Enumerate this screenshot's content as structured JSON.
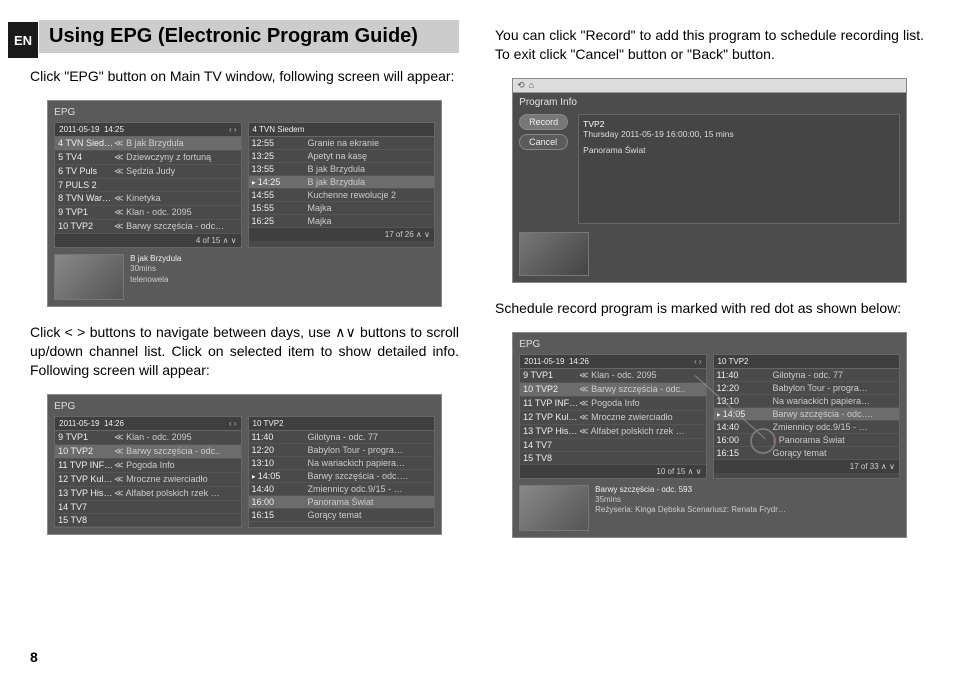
{
  "langBadge": "EN",
  "pageNumber": "8",
  "header": "Using EPG (Electronic Program Guide)",
  "para1": "Click \"EPG\" button on Main TV window, following screen will appear:",
  "para2": "Click < > buttons to navigate between days, use ∧∨ buttons to scroll up/down channel list. Click on selected item to show detailed info. Following screen will appear:",
  "para3": "You can click \"Record\" to add this program to schedule recording list. To exit click \"Cancel\" button or \"Back\" button.",
  "para4": "Schedule record program is marked with red dot as shown below:",
  "shot1": {
    "title": "EPG",
    "date": "2011-05-19",
    "time": "14:25",
    "rightHeader": "4 TVN Siedem",
    "leftRows": [
      {
        "ch": "4 TVN Siedem",
        "prog": "≪ B jak Brzydula",
        "sel": true
      },
      {
        "ch": "5 TV4",
        "prog": "≪ Dziewczyny z fortuną"
      },
      {
        "ch": "6 TV Puls",
        "prog": "≪ Sędzia Judy"
      },
      {
        "ch": "7 PULS 2",
        "prog": ""
      },
      {
        "ch": "8 TVN Warsz…",
        "prog": "≪ Kinetyka"
      },
      {
        "ch": "9 TVP1",
        "prog": "≪ Klan - odc. 2095"
      },
      {
        "ch": "10 TVP2",
        "prog": "≪ Barwy szczęścia - odc…"
      }
    ],
    "leftPager": "4 of 15  ∧ ∨",
    "rightRows": [
      {
        "t": "12:55",
        "p": "Granie na ekranie"
      },
      {
        "t": "13:25",
        "p": "Apetyt na kasę"
      },
      {
        "t": "13:55",
        "p": "B jak Brzydula"
      },
      {
        "t": "14:25",
        "p": "B jak Brzydula",
        "sel": true,
        "play": true
      },
      {
        "t": "14:55",
        "p": "Kuchenne rewolucje 2"
      },
      {
        "t": "15:55",
        "p": "Majka"
      },
      {
        "t": "16:25",
        "p": "Majka"
      }
    ],
    "rightPager": "17 of 26  ∧ ∨",
    "detailTitle": "B jak Brzydula",
    "detailDur": "30mins",
    "detailGenre": "telenowela"
  },
  "shot2": {
    "title": "EPG",
    "date": "2011-05-19",
    "time": "14:26",
    "rightHeader": "10 TVP2",
    "leftRows": [
      {
        "ch": "9 TVP1",
        "prog": "≪ Klan - odc. 2095"
      },
      {
        "ch": "10 TVP2",
        "prog": "≪ Barwy szczęścia - odc..",
        "sel": true
      },
      {
        "ch": "11 TVP INFO …",
        "prog": "≪ Pogoda Info"
      },
      {
        "ch": "12 TVP Kultura",
        "prog": "≪ Mroczne zwierciadło"
      },
      {
        "ch": "13 TVP Historia",
        "prog": "≪ Alfabet polskich rzek …"
      },
      {
        "ch": "14 TV7",
        "prog": ""
      },
      {
        "ch": "15 TV8",
        "prog": ""
      }
    ],
    "rightRows": [
      {
        "t": "11:40",
        "p": "Gilotyna - odc. 77"
      },
      {
        "t": "12:20",
        "p": "Babylon Tour - progra…"
      },
      {
        "t": "13:10",
        "p": "Na wariackich papiera…"
      },
      {
        "t": "14:05",
        "p": "Barwy szczęścia - odc….",
        "play": true
      },
      {
        "t": "14:40",
        "p": "Zmiennicy odc.9/15 - …"
      },
      {
        "t": "16:00",
        "p": "Panorama Świat",
        "sel": true
      },
      {
        "t": "16:15",
        "p": "Gorący temat"
      }
    ]
  },
  "shot3": {
    "title": "Program Info",
    "recordBtn": "Record",
    "cancelBtn": "Cancel",
    "channel": "TVP2",
    "schedule": "Thursday 2011-05-19 16:00:00, 15 mins",
    "program": "Panorama Świat"
  },
  "shot4": {
    "title": "EPG",
    "date": "2011-05-19",
    "time": "14:26",
    "rightHeader": "10 TVP2",
    "leftRows": [
      {
        "ch": "9 TVP1",
        "prog": "≪ Klan - odc. 2095"
      },
      {
        "ch": "10 TVP2",
        "prog": "≪ Barwy szczęścia - odc..",
        "sel": true
      },
      {
        "ch": "11 TVP INFO …",
        "prog": "≪ Pogoda Info"
      },
      {
        "ch": "12 TVP Kultura",
        "prog": "≪ Mroczne zwierciadło"
      },
      {
        "ch": "13 TVP Historia",
        "prog": "≪ Alfabet polskich rzek …"
      },
      {
        "ch": "14 TV7",
        "prog": ""
      },
      {
        "ch": "15 TV8",
        "prog": ""
      }
    ],
    "leftPager": "10 of 15  ∧ ∨",
    "rightRows": [
      {
        "t": "11:40",
        "p": "Gilotyna - odc. 77"
      },
      {
        "t": "12:20",
        "p": "Babylon Tour - progra…"
      },
      {
        "t": "13:10",
        "p": "Na wariackich papiera…"
      },
      {
        "t": "14:05",
        "p": "Barwy szczęścia - odc….",
        "sel": true,
        "play": true
      },
      {
        "t": "14:40",
        "p": "Zmiennicy odc.9/15 - …"
      },
      {
        "t": "16:00",
        "p": "Panorama Świat",
        "dot": true
      },
      {
        "t": "16:15",
        "p": "Gorący temat"
      }
    ],
    "rightPager": "17 of 33  ∧ ∨",
    "detailTitle": "Barwy szczęścia - odc. 593",
    "detailDur": "35mins",
    "detailCredits": "Reżyseria: Kinga Dębska Scenariusz: Renata Frydr…"
  }
}
